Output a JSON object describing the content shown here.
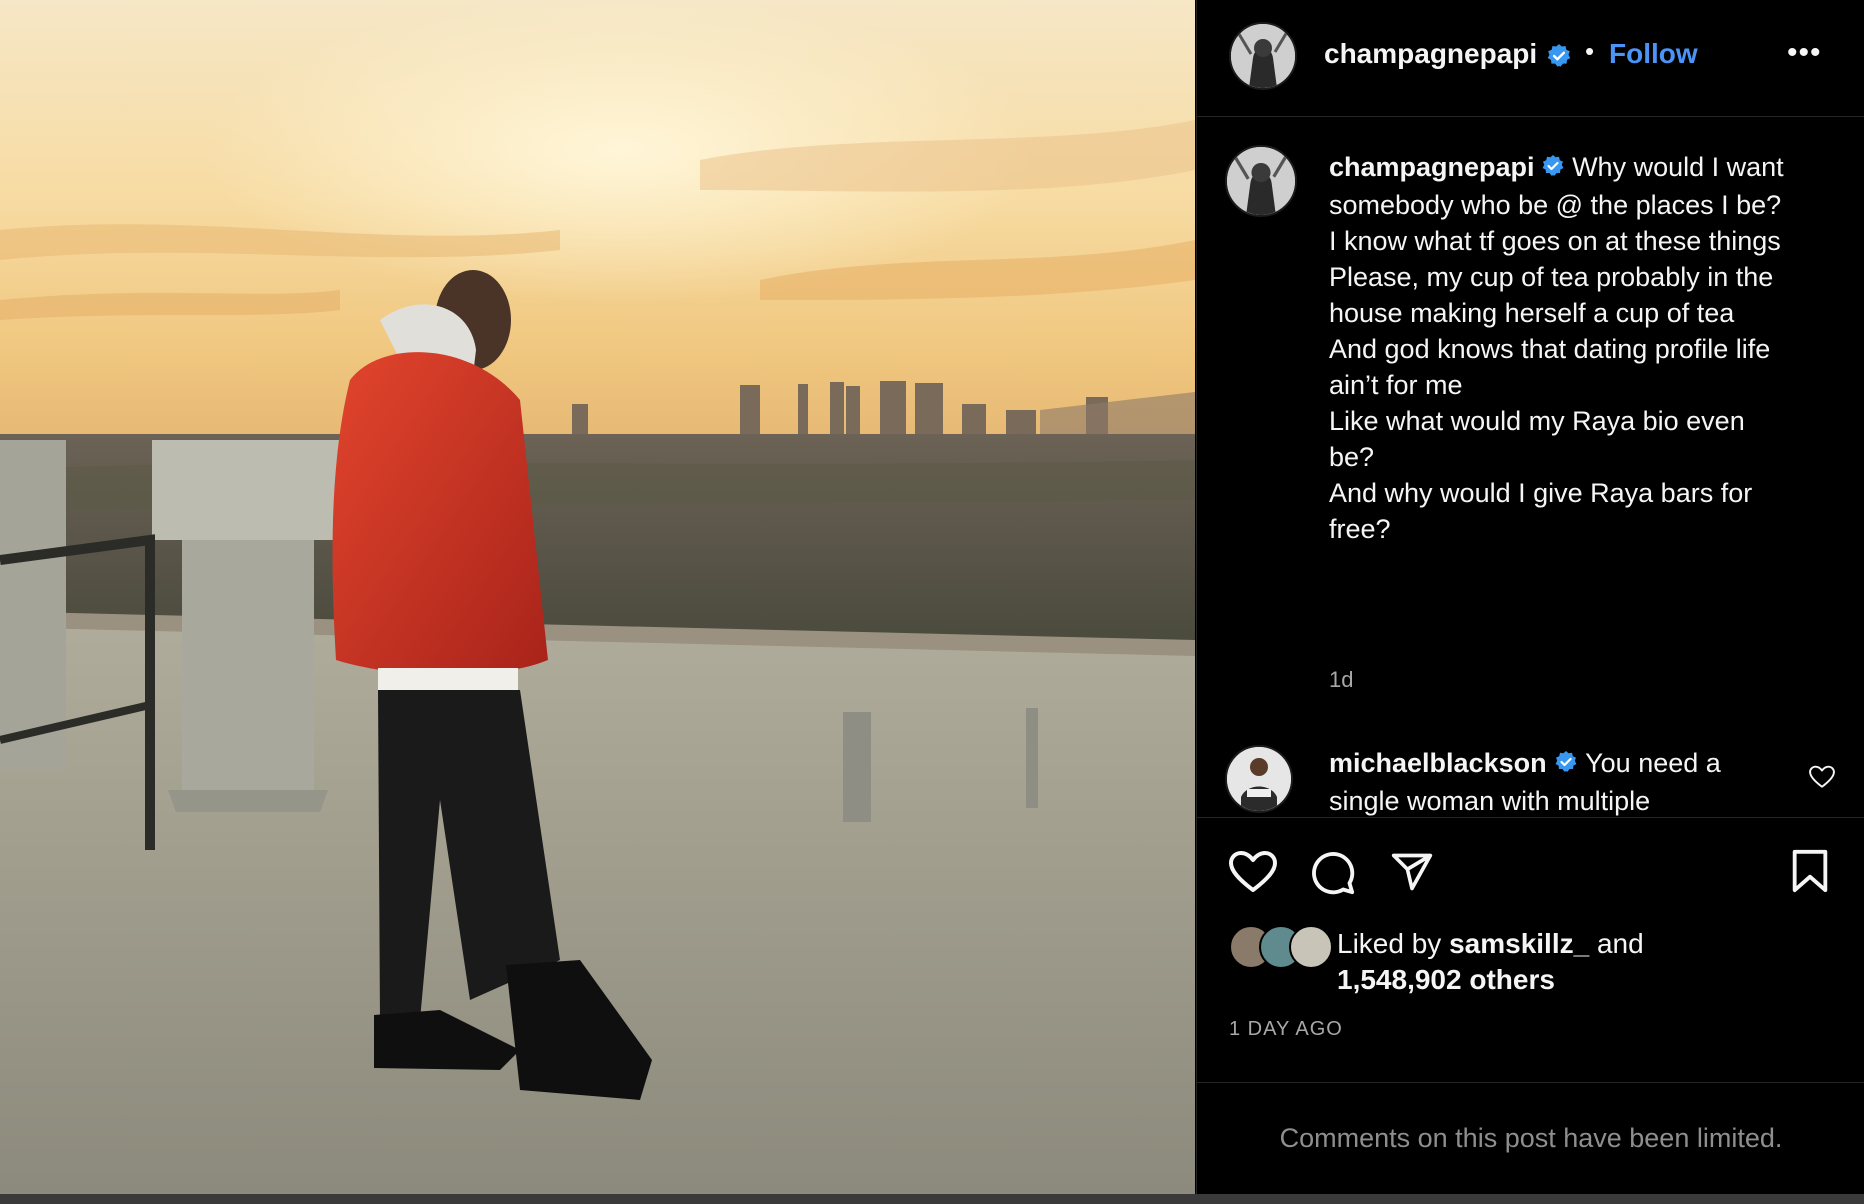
{
  "post": {
    "author": "champagnepapi",
    "follow_label": "Follow",
    "separator": "•",
    "more_label": "•••",
    "photo_alt": "photo"
  },
  "caption": {
    "author": "champagnepapi",
    "text": "Why would I want somebody who be @ the places I be?\nI know what tf goes on at these things\nPlease, my cup of tea probably in the house making herself a cup of tea\nAnd god knows that dating profile life ain’t for me\nLike what would my Raya bio even be?\nAnd why would I give Raya bars for free?",
    "time_ago": "1d"
  },
  "comment": {
    "author": "michaelblackson",
    "text": "You need a single woman with multiple"
  },
  "actions": {
    "like_icon": "heart-icon",
    "comment_icon": "comment-icon",
    "share_icon": "share-icon",
    "save_icon": "bookmark-icon"
  },
  "likes": {
    "prefix": "Liked by",
    "user": "samskillz_",
    "connector": "and",
    "count": "1,548,902 others"
  },
  "date_label": "1 DAY AGO",
  "comments_limited": "Comments on this post have been limited.",
  "colors": {
    "accent": "#4a94f7",
    "background": "#000000",
    "verified": "#3897f0",
    "muted": "#a8a8a8"
  }
}
